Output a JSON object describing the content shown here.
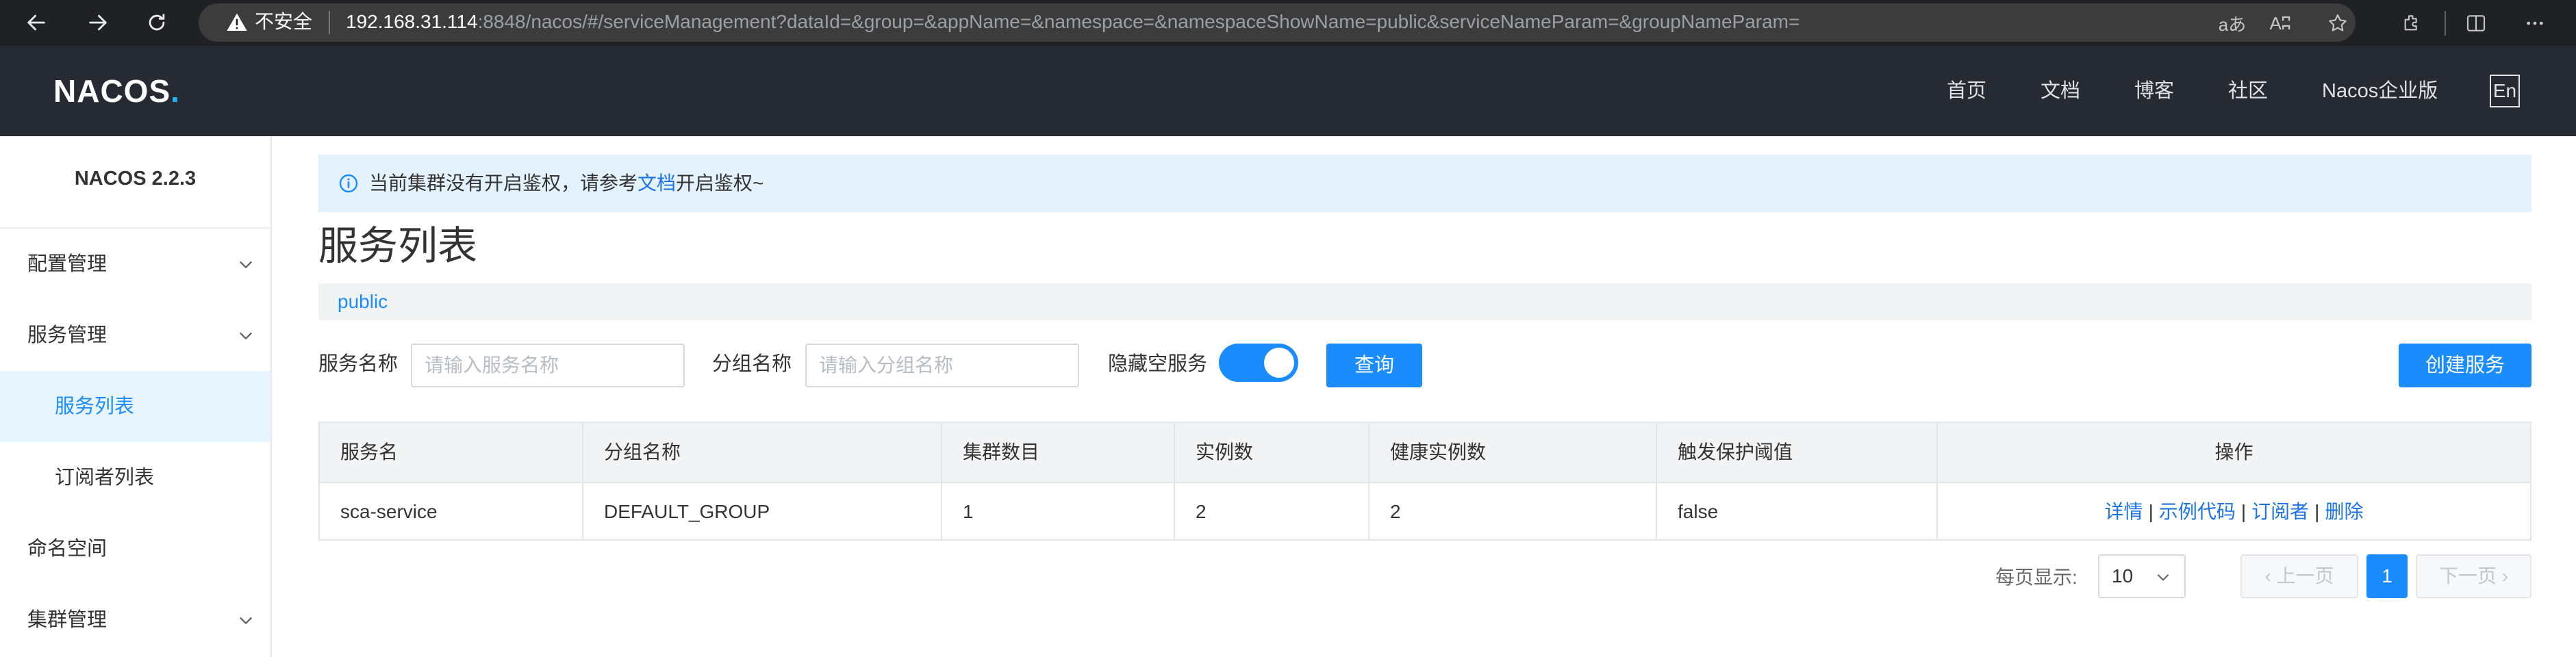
{
  "browser": {
    "security_label": "不安全",
    "url_host": "192.168.31.114",
    "url_rest": ":8848/nacos/#/serviceManagement?dataId=&group=&appName=&namespace=&namespaceShowName=public&serviceNameParam=&groupNameParam=",
    "read_aloud_label": "Aʭ",
    "translate_label": "aあ"
  },
  "header": {
    "logo_text": "NACOS",
    "logo_dot": ".",
    "nav": [
      "首页",
      "文档",
      "博客",
      "社区",
      "Nacos企业版"
    ],
    "lang_button": "En"
  },
  "sidebar": {
    "version": "NACOS 2.2.3",
    "items": [
      {
        "label": "配置管理",
        "expandable": true
      },
      {
        "label": "服务管理",
        "expandable": true
      },
      {
        "label": "服务列表",
        "active": true
      },
      {
        "label": "订阅者列表"
      },
      {
        "label": "命名空间"
      },
      {
        "label": "集群管理",
        "expandable": true
      }
    ]
  },
  "notice": {
    "text_before": "当前集群没有开启鉴权，请参考",
    "link": "文档",
    "text_after": "开启鉴权~"
  },
  "page": {
    "title": "服务列表",
    "namespace": "public"
  },
  "filters": {
    "service_name_label": "服务名称",
    "service_name_placeholder": "请输入服务名称",
    "service_name_value": "",
    "group_name_label": "分组名称",
    "group_name_placeholder": "请输入分组名称",
    "group_name_value": "",
    "hide_empty_label": "隐藏空服务",
    "hide_empty_on": true,
    "query_button": "查询",
    "create_button": "创建服务"
  },
  "table": {
    "headers": [
      "服务名",
      "分组名称",
      "集群数目",
      "实例数",
      "健康实例数",
      "触发保护阈值",
      "操作"
    ],
    "rows": [
      {
        "service": "sca-service",
        "group": "DEFAULT_GROUP",
        "clusters": "1",
        "instances": "2",
        "healthy": "2",
        "threshold": "false",
        "actions": [
          "详情",
          "示例代码",
          "订阅者",
          "删除"
        ]
      }
    ],
    "action_separator": "|"
  },
  "pagination": {
    "page_size_label": "每页显示:",
    "page_size": "10",
    "prev": "上一页",
    "current": "1",
    "next": "下一页"
  },
  "colors": {
    "header_bg": "#252a33",
    "primary": "#1a8cff",
    "notice_bg": "#e3f2fd",
    "link": "#1a73e8"
  }
}
